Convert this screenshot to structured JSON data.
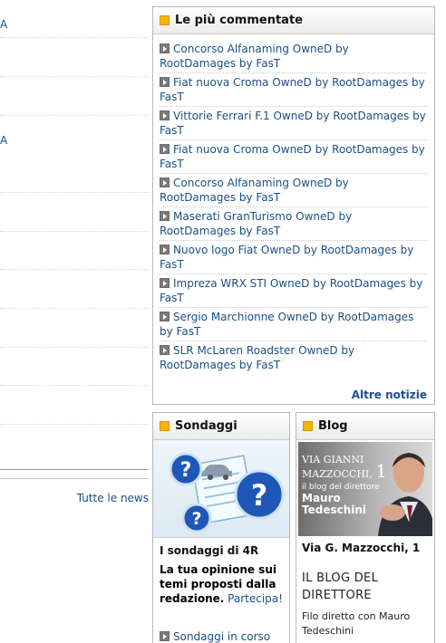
{
  "left": {
    "chars": [
      "A",
      "A"
    ],
    "tutte_label": "Tutte le news"
  },
  "commentate": {
    "title": "Le più commentate",
    "items": [
      "Concorso Alfanaming OwneD by RootDamages by FasT",
      "Fiat nuova Croma OwneD by RootDamages by FasT",
      "Vittorie Ferrari F.1 OwneD by RootDamages by FasT",
      "Fiat nuova Croma OwneD by RootDamages by FasT",
      "Concorso Alfanaming OwneD by RootDamages by FasT",
      "Maserati GranTurismo OwneD by RootDamages by FasT",
      "Nuovo logo Fiat OwneD by RootDamages by FasT",
      "Impreza WRX STI OwneD by RootDamages by FasT",
      "Sergio Marchionne OwneD by RootDamages by FasT",
      "SLR McLaren Roadster OwneD by RootDamages by FasT"
    ],
    "more_label": "Altre notizie"
  },
  "sondaggi": {
    "title": "Sondaggi",
    "subtitle": "I sondaggi di 4R",
    "text_bold": "La tua opinione sui temi proposti dalla redazione.",
    "cta": "Partecipa!",
    "link": "Sondaggi in corso"
  },
  "blog": {
    "title": "Blog",
    "img_line1": "VIA GIANNI",
    "img_line2": "MAZZOCCHI,",
    "img_num": "1",
    "img_line3": "il blog del direttore",
    "img_name1": "Mauro",
    "img_name2": "Tedeschini",
    "caption": "Via G. Mazzocchi, 1",
    "heading": "IL BLOG DEL DIRETTORE",
    "text": "Filo diretto con Mauro Tedeschini"
  },
  "colors": {
    "link": "#1b4f86",
    "accent_square": "#f4b400"
  }
}
